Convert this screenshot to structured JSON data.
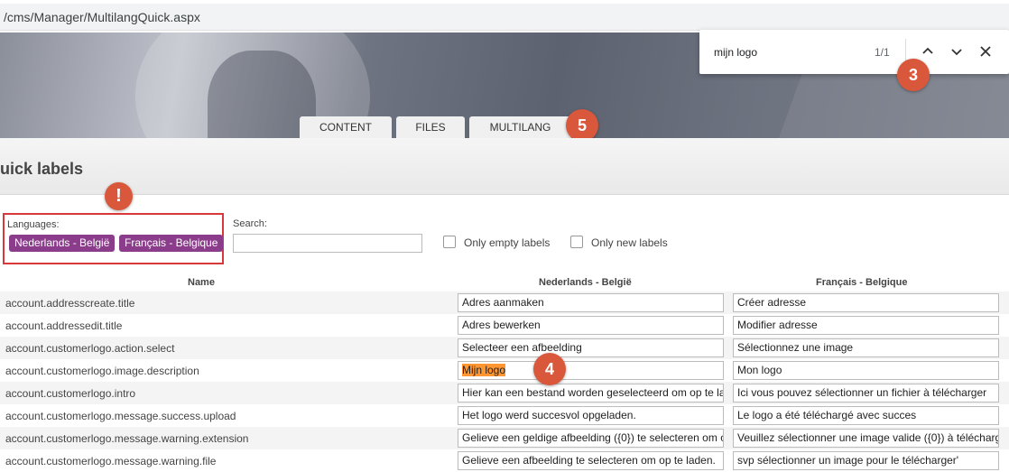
{
  "browser": {
    "url": "/cms/Manager/MultilangQuick.aspx"
  },
  "find_bar": {
    "query": "mijn logo",
    "count": "1/1"
  },
  "nav_tabs": [
    {
      "label": "CONTENT"
    },
    {
      "label": "FILES"
    },
    {
      "label": "MULTILANG"
    }
  ],
  "page": {
    "title": "uick labels"
  },
  "badges": {
    "alert": "!",
    "find": "3",
    "tabs": "5",
    "match": "4"
  },
  "filters": {
    "languages_label": "Languages:",
    "languages": [
      "Nederlands - België",
      "Français - Belgique"
    ],
    "search_label": "Search:",
    "search_value": "",
    "only_empty_label": "Only empty labels",
    "only_new_label": "Only new labels"
  },
  "table": {
    "headers": {
      "name": "Name",
      "nl": "Nederlands - België",
      "fr": "Français - Belgique"
    },
    "rows": [
      {
        "name": "account.addresscreate.title",
        "nl": "Adres aanmaken",
        "fr": "Créer adresse"
      },
      {
        "name": "account.addressedit.title",
        "nl": "Adres bewerken",
        "fr": "Modifier adresse"
      },
      {
        "name": "account.customerlogo.action.select",
        "nl": "Selecteer een afbeelding",
        "fr": "Sélectionnez une image"
      },
      {
        "name": "account.customerlogo.image.description",
        "nl": "Mijn logo",
        "fr": "Mon logo"
      },
      {
        "name": "account.customerlogo.intro",
        "nl": "Hier kan een bestand worden geselecteerd om op te la",
        "fr": "Ici vous pouvez sélectionner un fichier à télécharger"
      },
      {
        "name": "account.customerlogo.message.success.upload",
        "nl": "Het logo werd succesvol opgeladen.",
        "fr": "Le logo a été téléchargé avec succes"
      },
      {
        "name": "account.customerlogo.message.warning.extension",
        "nl": "Gelieve een geldige afbeelding ({0}) te selecteren om o",
        "fr": "Veuillez sélectionner une image valide  ({0}) à télécharg"
      },
      {
        "name": "account.customerlogo.message.warning.file",
        "nl": "Gelieve een afbeelding te selecteren om op te laden.",
        "fr": "svp sélectionner un image pour le télécharger'"
      }
    ]
  },
  "colors": {
    "accent_badge": "#d9583b",
    "language_pill": "#8b3d8b",
    "find_highlight": "#ff9632",
    "alert_border": "#d9383b"
  }
}
